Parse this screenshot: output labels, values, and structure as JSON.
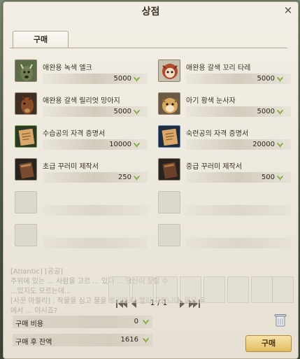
{
  "window": {
    "title": "상점",
    "close_icon": "close-icon"
  },
  "tabs": [
    {
      "label": "구매"
    }
  ],
  "currency_icon": "leaf-currency-icon",
  "items": [
    {
      "name": "애완용 녹색 엘크",
      "price": "5000",
      "icon": "green-elk-icon"
    },
    {
      "name": "애완용 갈색 꼬리 타레",
      "price": "5000",
      "icon": "brown-tail-tare-icon"
    },
    {
      "name": "애완용 갈색 릴리엇 망아지",
      "price": "5000",
      "icon": "brown-foal-icon"
    },
    {
      "name": "아기 황색 눈사자",
      "price": "5000",
      "icon": "yellow-snow-lion-icon"
    },
    {
      "name": "수습공의 자격 증명서",
      "price": "10000",
      "icon": "apprentice-certificate-icon"
    },
    {
      "name": "숙련공의 자격 증명서",
      "price": "20000",
      "icon": "journeyman-certificate-icon"
    },
    {
      "name": "초급 꾸러미 제작서",
      "price": "250",
      "icon": "basic-bundle-book-icon"
    },
    {
      "name": "중급 꾸러미 제작서",
      "price": "500",
      "icon": "intermediate-bundle-book-icon"
    }
  ],
  "pager": {
    "text": "1 / 1"
  },
  "summary": {
    "cost_label": "구매 비용",
    "cost_value": "0",
    "balance_label": "구매 후 잔액",
    "balance_value": "1616"
  },
  "buy_button": "구매",
  "background_chat": [
    "[Atlantic] [공공]",
    "주위에 있는 ... 사람을 고르 ... 있다 ... 당신이 잘할 수",
    "...있지도 모르는데...",
    "[사꾼 마퀄리] : 작물을 심고 물을 뿌리면 더 빨리 자랍니다. 물은 우",
    "에서 ... 이시죠?"
  ]
}
